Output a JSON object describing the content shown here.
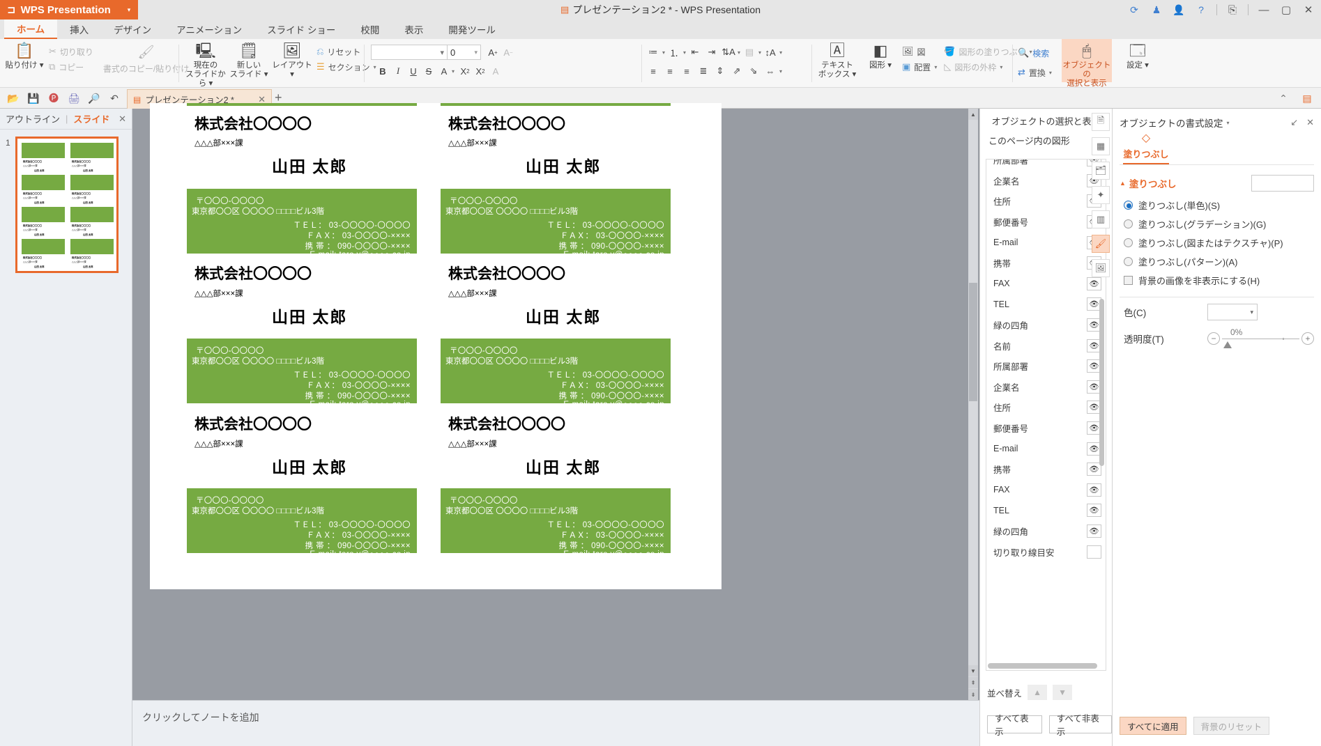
{
  "titlebar": {
    "app_name": "WPS Presentation",
    "document_title": "プレゼンテーション2 * - WPS Presentation",
    "right_icons": [
      "sync-icon",
      "shirt-icon",
      "user-icon",
      "help-icon",
      "upload-icon",
      "minimize-icon",
      "maximize-icon",
      "close-icon"
    ]
  },
  "ribbon_tabs": [
    {
      "label": "ホーム",
      "active": true
    },
    {
      "label": "挿入",
      "active": false
    },
    {
      "label": "デザイン",
      "active": false
    },
    {
      "label": "アニメーション",
      "active": false
    },
    {
      "label": "スライド ショー",
      "active": false
    },
    {
      "label": "校閲",
      "active": false
    },
    {
      "label": "表示",
      "active": false
    },
    {
      "label": "開発ツール",
      "active": false
    }
  ],
  "ribbon": {
    "paste": "貼り付け",
    "cut": "切り取り",
    "copy": "コピー",
    "format_painter": "書式のコピー/貼り付け",
    "from_current_slide_1": "現在の",
    "from_current_slide_2": "スライドから",
    "new_slide_1": "新しい",
    "new_slide_2": "スライド",
    "layout": "レイアウト",
    "reset": "リセット",
    "section": "セクション",
    "font_name": "",
    "font_size": "0",
    "grow_font": "A",
    "shrink_font": "A",
    "bold": "B",
    "italic": "I",
    "underline": "U",
    "strike": "S",
    "font_color": "A",
    "superscript": "X",
    "subscript": "X",
    "clear_format": "A",
    "textbox_1": "テキスト",
    "textbox_2": "ボックス",
    "shapes": "図形",
    "picture": "図",
    "arrange": "配置",
    "shape_fill": "図形の塗りつぶし",
    "shape_outline": "図形の外枠",
    "find": "検索",
    "replace": "置換",
    "select_pane_1": "オブジェクトの",
    "select_pane_2": "選択と表示",
    "settings": "設定"
  },
  "quickbar": {
    "icons": [
      "open-icon",
      "save-icon",
      "export-pdf-icon",
      "print-icon",
      "print-preview-icon",
      "undo-icon",
      "redo-icon",
      "more-icon"
    ],
    "file_tab": "プレゼンテーション2 *",
    "new_tab": "+"
  },
  "left_panel": {
    "tab_outline": "アウトライン",
    "tab_slides": "スライド",
    "slide_number": "1"
  },
  "slide": {
    "cards": [
      {
        "postal": "〒〇〇〇-〇〇〇〇",
        "address": "東京都〇〇区 〇〇〇〇 □□□□ビル3階",
        "tel": "ＴＥＬ： 03-〇〇〇〇-〇〇〇〇",
        "fax": "ＦＡＸ： 03-〇〇〇〇-××××",
        "mobile": "携 帯 ： 090-〇〇〇〇-××××",
        "email": "E-mail:  taro.y@●●●●.co.jp"
      }
    ],
    "company": "株式会社〇〇〇〇",
    "department": "△△△部×××課",
    "person_name": "山田 太郎"
  },
  "notes": {
    "placeholder": "クリックしてノートを追加"
  },
  "object_panel": {
    "title": "オブジェクトの選択と表示",
    "subtitle": "このページ内の図形",
    "items": [
      {
        "label": "所属部署",
        "visible": true
      },
      {
        "label": "企業名",
        "visible": true
      },
      {
        "label": "住所",
        "visible": true
      },
      {
        "label": "郵便番号",
        "visible": true
      },
      {
        "label": "E-mail",
        "visible": true
      },
      {
        "label": "携帯",
        "visible": true
      },
      {
        "label": "FAX",
        "visible": true
      },
      {
        "label": "TEL",
        "visible": true
      },
      {
        "label": "緑の四角",
        "visible": true
      },
      {
        "label": "名前",
        "visible": true
      },
      {
        "label": "所属部署",
        "visible": true
      },
      {
        "label": "企業名",
        "visible": true
      },
      {
        "label": "住所",
        "visible": true
      },
      {
        "label": "郵便番号",
        "visible": true
      },
      {
        "label": "E-mail",
        "visible": true
      },
      {
        "label": "携帯",
        "visible": true
      },
      {
        "label": "FAX",
        "visible": true
      },
      {
        "label": "TEL",
        "visible": true
      },
      {
        "label": "緑の四角",
        "visible": true
      },
      {
        "label": "切り取り線目安",
        "visible": false
      }
    ],
    "sort_label": "並べ替え",
    "show_all": "すべて表示",
    "hide_all": "すべて非表示"
  },
  "format_panel": {
    "title": "オブジェクトの書式設定",
    "tab_fill": "塗りつぶし",
    "section_fill": "塗りつぶし",
    "options": [
      {
        "label": "塗りつぶし(単色)(S)",
        "selected": true
      },
      {
        "label": "塗りつぶし(グラデーション)(G)",
        "selected": false
      },
      {
        "label": "塗りつぶし(図またはテクスチャ)(P)",
        "selected": false
      },
      {
        "label": "塗りつぶし(パターン)(A)",
        "selected": false
      }
    ],
    "hide_bg_image": "背景の画像を非表示にする(H)",
    "color_label": "色(C)",
    "transparency_label": "透明度(T)",
    "transparency_value": "0%",
    "apply_all": "すべてに適用",
    "reset_bg": "背景のリセット"
  },
  "colors": {
    "accent": "#e8692b",
    "card_green": "#76aa42",
    "ribbon_bg": "#f7f7f7",
    "workarea": "#989ca3"
  }
}
